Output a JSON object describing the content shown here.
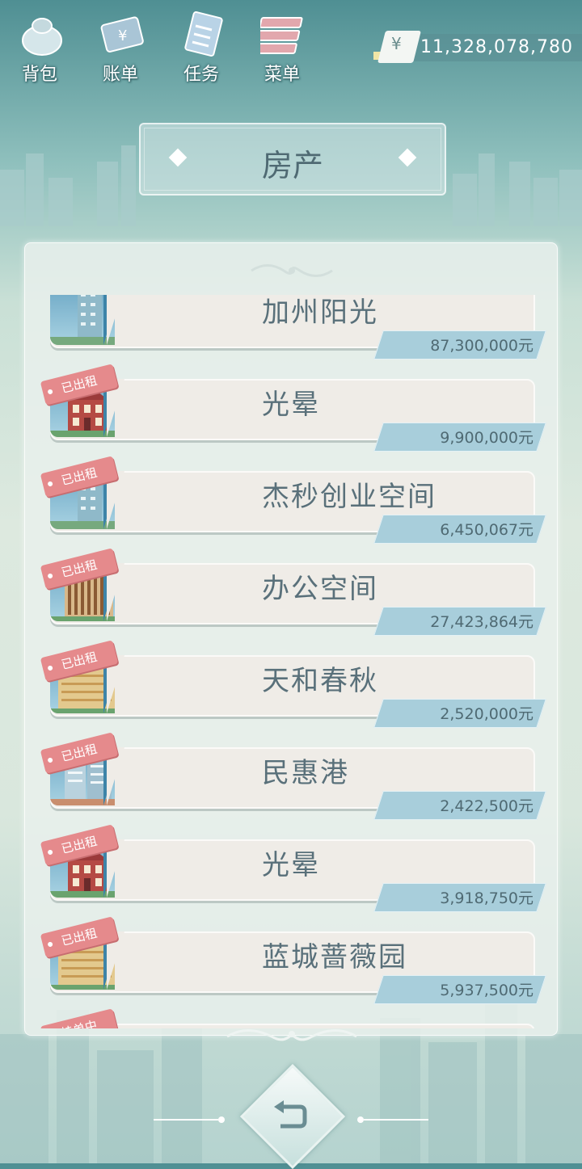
{
  "topbar": {
    "tools": [
      {
        "label": "背包",
        "icon": "backpack-icon"
      },
      {
        "label": "账单",
        "icon": "bill-icon"
      },
      {
        "label": "任务",
        "icon": "task-icon"
      },
      {
        "label": "菜单",
        "icon": "menu-icon"
      }
    ],
    "currency_symbol": "¥",
    "money": "11,328,078,780"
  },
  "page_title": "房产",
  "properties": [
    {
      "name": "加州阳光",
      "price": "87,300,000元",
      "tag": "",
      "building": "tower"
    },
    {
      "name": "光晕",
      "price": "9,900,000元",
      "tag": "已出租",
      "building": "house"
    },
    {
      "name": "杰秒创业空间",
      "price": "6,450,067元",
      "tag": "已出租",
      "building": "tower"
    },
    {
      "name": "办公空间",
      "price": "27,423,864元",
      "tag": "已出租",
      "building": "office"
    },
    {
      "name": "天和春秋",
      "price": "2,520,000元",
      "tag": "已出租",
      "building": "apartment"
    },
    {
      "name": "民惠港",
      "price": "2,422,500元",
      "tag": "已出租",
      "building": "highrise"
    },
    {
      "name": "光晕",
      "price": "3,918,750元",
      "tag": "已出租",
      "building": "house"
    },
    {
      "name": "蓝城蔷薇园",
      "price": "5,937,500元",
      "tag": "已出租",
      "building": "apartment"
    },
    {
      "name": "",
      "price": "",
      "tag": "挂单中",
      "building": "tower"
    }
  ],
  "colors": {
    "accent": "#a8cedb",
    "tag": "#e58a8c",
    "text": "#59707a"
  }
}
